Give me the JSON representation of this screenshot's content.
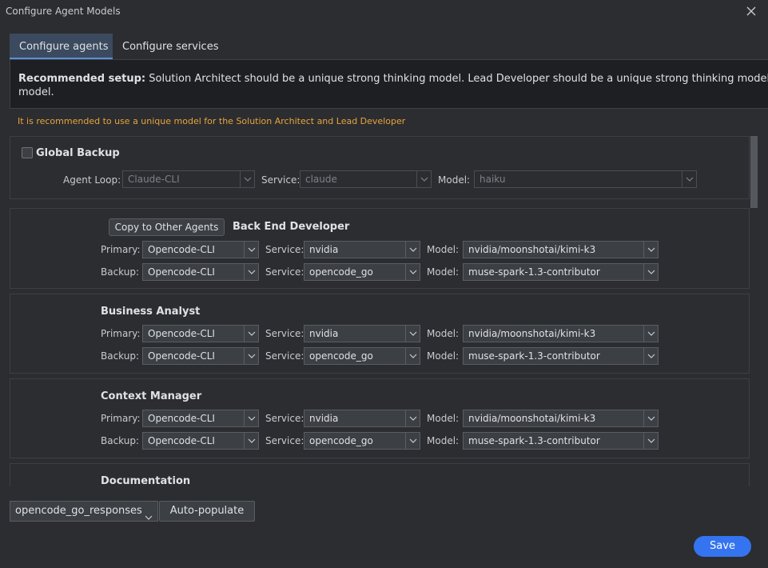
{
  "window": {
    "title": "Configure Agent Models"
  },
  "tabs": [
    {
      "label": "Configure agents",
      "active": true
    },
    {
      "label": "Configure services",
      "active": false
    }
  ],
  "recommendation": {
    "heading": "Recommended setup:",
    "text": " Solution Architect should be a unique strong thinking model. Lead Developer should be a unique strong thinking model. All oth",
    "text2": "model."
  },
  "warning": "It is recommended to use a unique model for the Solution Architect and Lead Developer",
  "global_backup": {
    "label": "Global Backup",
    "checked": false,
    "agent_loop_label": "Agent Loop:",
    "agent_loop": "Claude-CLI",
    "service_label": "Service:",
    "service": "claude",
    "model_label": "Model:",
    "model": "haiku"
  },
  "agents": [
    {
      "name": "Back End Developer",
      "copy_button": "Copy to Other Agents",
      "primary_label": "Primary:",
      "backup_label": "Backup:",
      "service_label": "Service:",
      "model_label": "Model:",
      "primary": {
        "loop": "Opencode-CLI",
        "service": "nvidia",
        "model": "nvidia/moonshotai/kimi-k3"
      },
      "backup": {
        "loop": "Opencode-CLI",
        "service": "opencode_go",
        "model": "muse-spark-1.3-contributor"
      }
    },
    {
      "name": "Business Analyst",
      "primary_label": "Primary:",
      "backup_label": "Backup:",
      "service_label": "Service:",
      "model_label": "Model:",
      "primary": {
        "loop": "Opencode-CLI",
        "service": "nvidia",
        "model": "nvidia/moonshotai/kimi-k3"
      },
      "backup": {
        "loop": "Opencode-CLI",
        "service": "opencode_go",
        "model": "muse-spark-1.3-contributor"
      }
    },
    {
      "name": "Context Manager",
      "primary_label": "Primary:",
      "backup_label": "Backup:",
      "service_label": "Service:",
      "model_label": "Model:",
      "primary": {
        "loop": "Opencode-CLI",
        "service": "nvidia",
        "model": "nvidia/moonshotai/kimi-k3"
      },
      "backup": {
        "loop": "Opencode-CLI",
        "service": "opencode_go",
        "model": "muse-spark-1.3-contributor"
      }
    },
    {
      "name": "Documentation"
    }
  ],
  "bottom": {
    "service_select": "opencode_go_responses",
    "autopopulate_label": "Auto-populate",
    "save_label": "Save"
  },
  "colors": {
    "accent": "#3574f0",
    "warning": "#e8a33d",
    "tab_active": "#3b4a5e"
  }
}
